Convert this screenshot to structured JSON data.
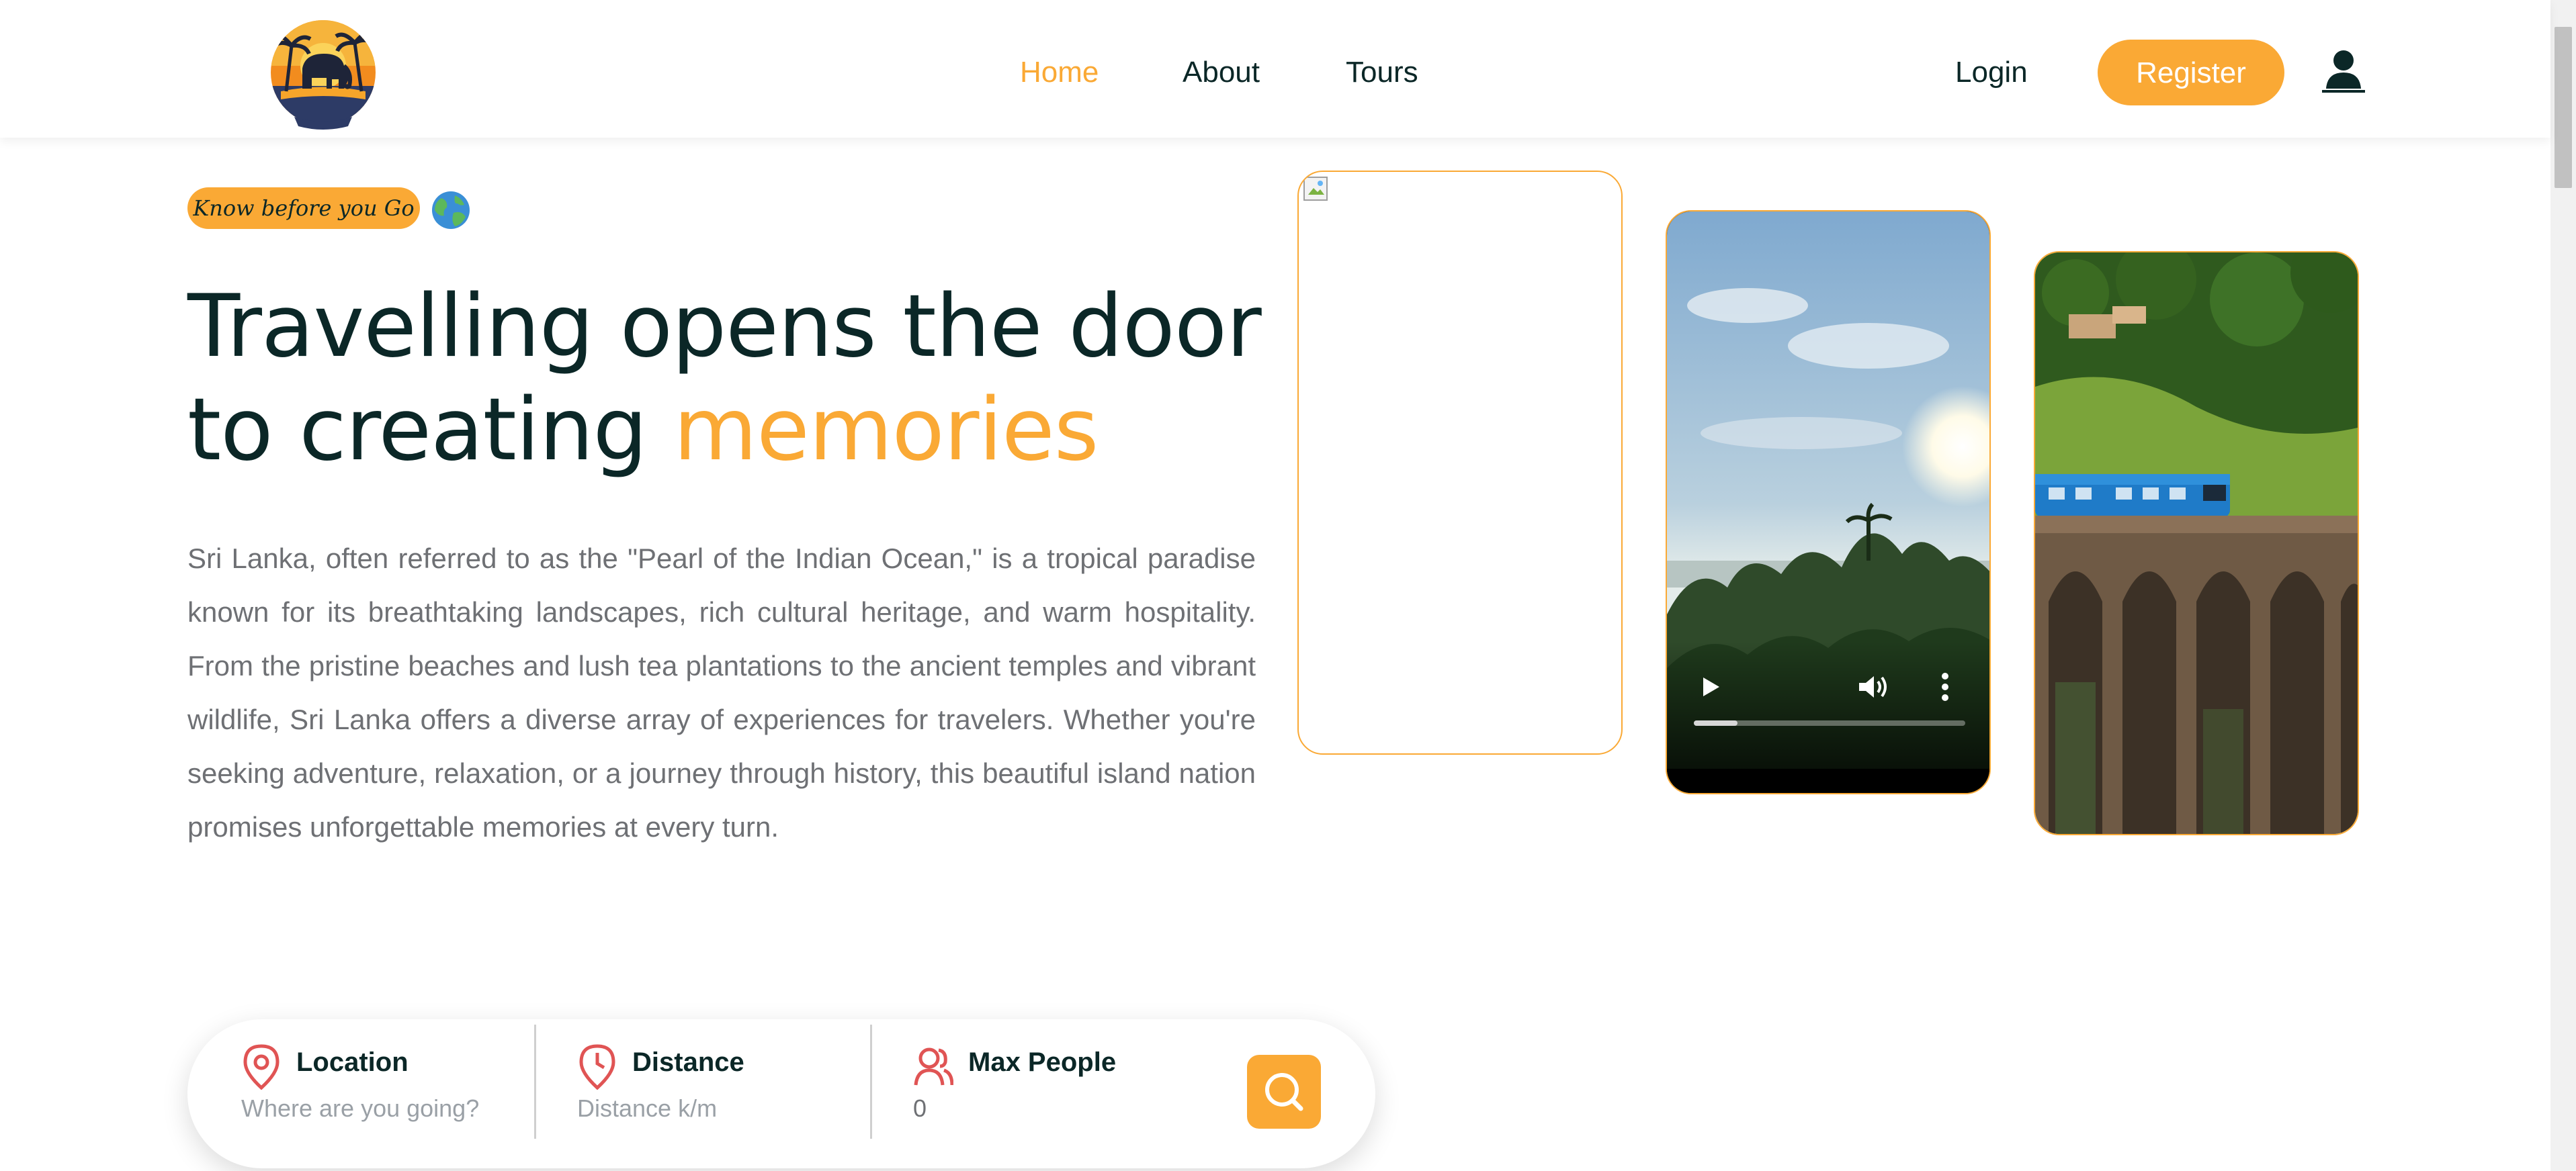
{
  "colors": {
    "accent": "#faa935",
    "heading": "#0b2727",
    "body_text": "#6e7074",
    "icon_red": "#e05454"
  },
  "header": {
    "logo_icon": "elephant-palm-sunset-logo",
    "nav": [
      {
        "label": "Home",
        "active": true
      },
      {
        "label": "About",
        "active": false
      },
      {
        "label": "Tours",
        "active": false
      }
    ],
    "login_label": "Login",
    "register_label": "Register",
    "user_icon": "user-icon"
  },
  "hero": {
    "subtitle": "Know before you Go",
    "subtitle_icon": "globe-icon",
    "title_prefix": "Travelling opens the door to creating ",
    "title_highlight": "memories",
    "description": "Sri Lanka, often referred to as the \"Pearl of the Indian Ocean,\" is a tropical paradise known for its breathtaking landscapes, rich cultural heritage, and warm hospitality. From the pristine beaches and lush tea plantations to the ancient temples and vibrant wildlife, Sri Lanka offers a diverse array of experiences for travelers. Whether you're seeking adventure, relaxation, or a journey through history, this beautiful island nation promises unforgettable memories at every turn.",
    "media": [
      {
        "kind": "image",
        "state": "broken"
      },
      {
        "kind": "video",
        "scene": "sunset-over-palm-trees",
        "progress": 0.16
      },
      {
        "kind": "image",
        "scene": "blue-train-on-nine-arch-bridge"
      }
    ]
  },
  "search": {
    "fields": [
      {
        "label": "Location",
        "placeholder": "Where are you going?",
        "icon": "location-pin-icon"
      },
      {
        "label": "Distance",
        "placeholder": "Distance k/m",
        "icon": "clock-pin-icon"
      },
      {
        "label": "Max People",
        "value": "0",
        "icon": "people-icon"
      }
    ],
    "search_icon": "search-icon"
  }
}
